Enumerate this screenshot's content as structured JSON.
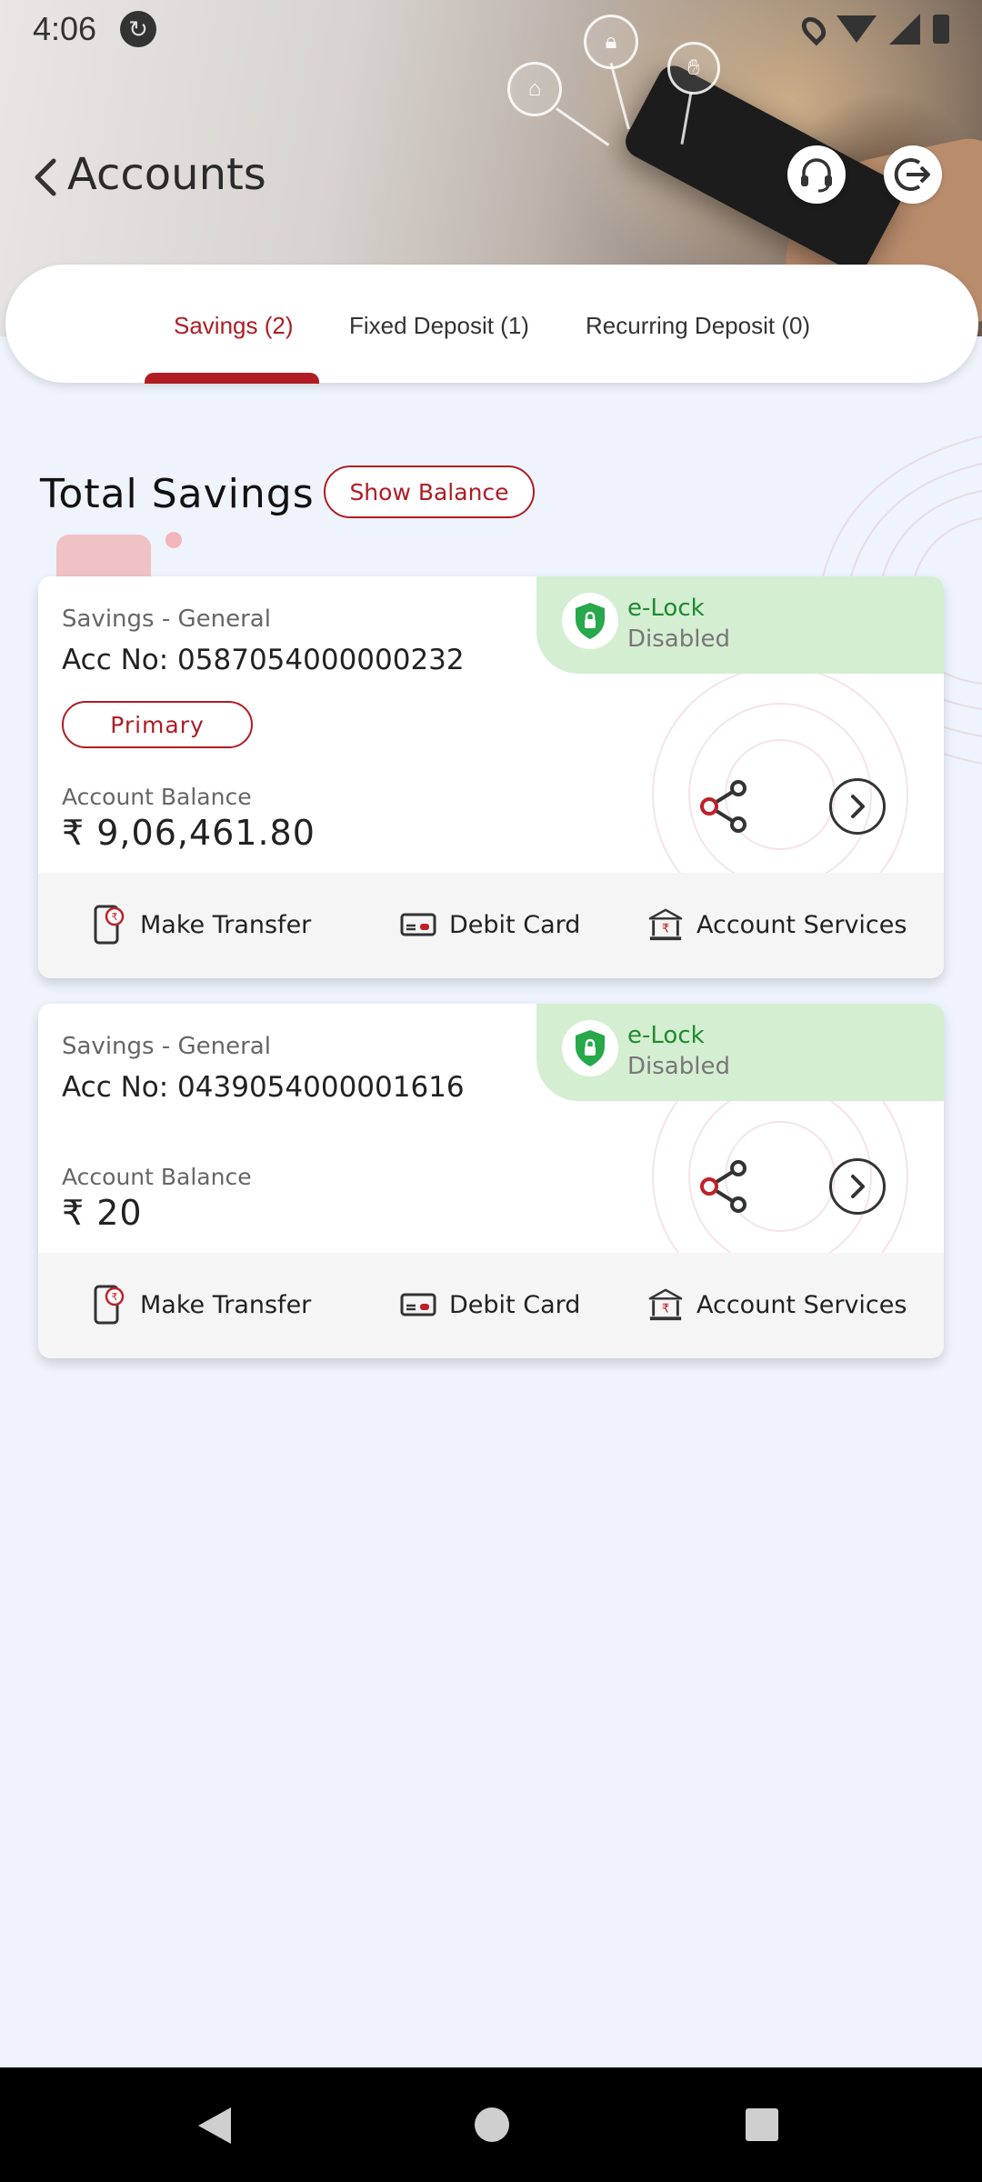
{
  "status_bar": {
    "time": "4:06"
  },
  "header": {
    "title": "Accounts"
  },
  "tabs": [
    {
      "label": "Savings (2)",
      "active": true
    },
    {
      "label": "Fixed Deposit (1)",
      "active": false
    },
    {
      "label": "Recurring Deposit (0)",
      "active": false
    }
  ],
  "section": {
    "title": "Total Savings",
    "show_balance_label": "Show Balance"
  },
  "accounts": [
    {
      "type": "Savings - General",
      "acc_no": "Acc No: 0587054000000232",
      "badge": "Primary",
      "elock_label": "e-Lock",
      "elock_status": "Disabled",
      "balance_label": "Account Balance",
      "balance": "₹ 9,06,461.80"
    },
    {
      "type": "Savings - General",
      "acc_no": "Acc No: 0439054000001616",
      "badge": null,
      "elock_label": "e-Lock",
      "elock_status": "Disabled",
      "balance_label": "Account Balance",
      "balance": "₹ 20"
    }
  ],
  "actions": {
    "make_transfer": "Make Transfer",
    "debit_card": "Debit Card",
    "account_services": "Account Services"
  },
  "colors": {
    "accent": "#b01c24",
    "elock_bg": "#d4eed2",
    "elock_text": "#1f8a2e",
    "page_bg": "#eef3fc"
  },
  "icons": [
    "back-arrow-icon",
    "headset-icon",
    "logout-icon",
    "shield-lock-icon",
    "share-icon",
    "chevron-right-circle-icon",
    "mobile-transfer-icon",
    "debit-card-icon",
    "bank-icon"
  ]
}
